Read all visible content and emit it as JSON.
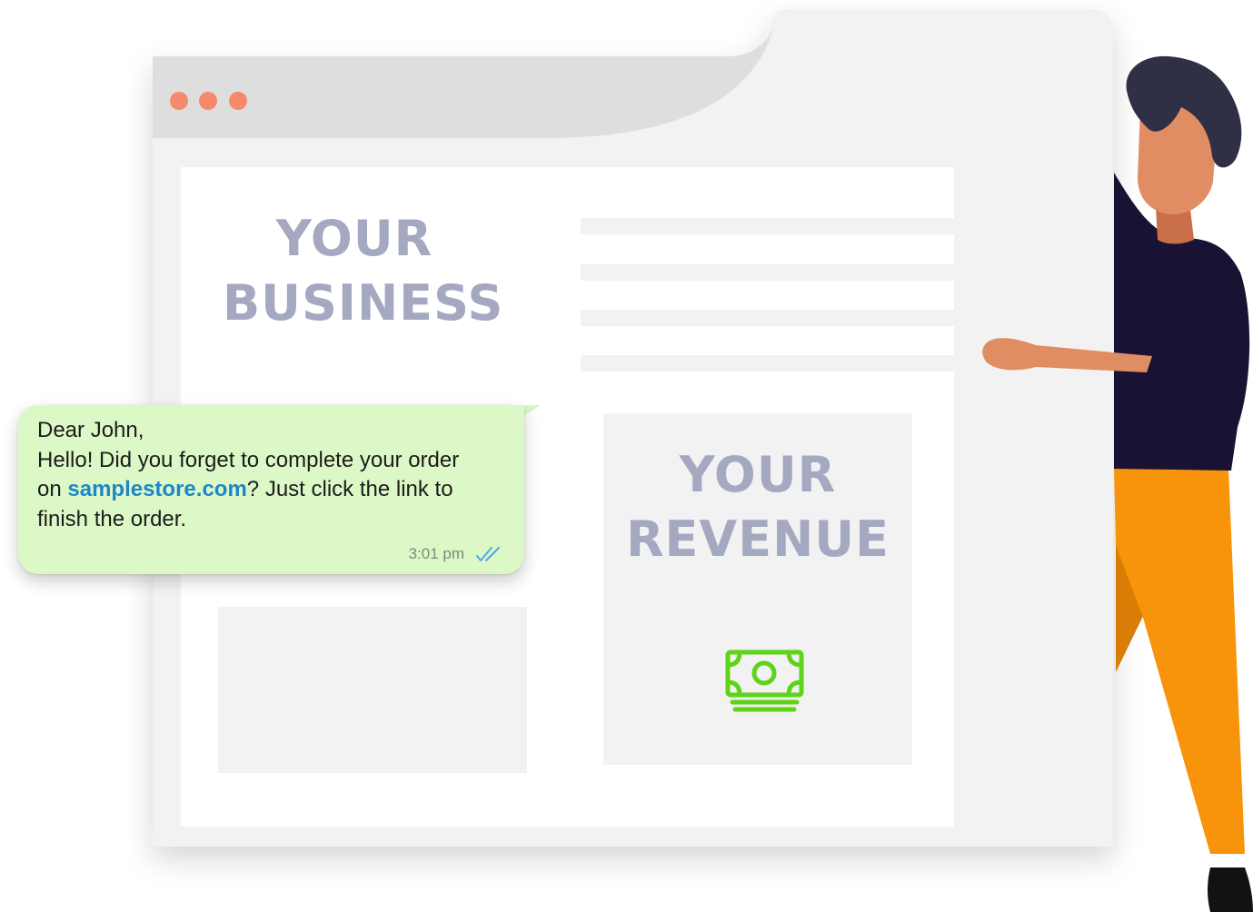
{
  "browser": {
    "window_controls": [
      "close-dot",
      "minimize-dot",
      "maximize-dot"
    ],
    "dot_color": "#f58a6b"
  },
  "business_card": {
    "line1": "YOUR",
    "line2": "BUSINESS"
  },
  "revenue_card": {
    "line1": "YOUR",
    "line2": "REVENUE",
    "icon": "money-icon",
    "icon_color": "#5ed318"
  },
  "chat_message": {
    "greeting": "Dear John,",
    "line2": "Hello! Did you forget to complete your order",
    "line3_prefix": "on ",
    "link_text": "samplestore.com",
    "line3_suffix": "? Just click the link to",
    "line4": "finish the order.",
    "time": "3:01 pm",
    "status_icon": "double-check-icon",
    "bubble_color": "#dcf8c6",
    "link_color": "#1d87c9"
  },
  "illustration": {
    "figure": "person-figure",
    "shirt_color": "#1a1233",
    "pants_color": "#f7940b",
    "hair_color": "#2f3046",
    "skin_color": "#e08d64"
  }
}
